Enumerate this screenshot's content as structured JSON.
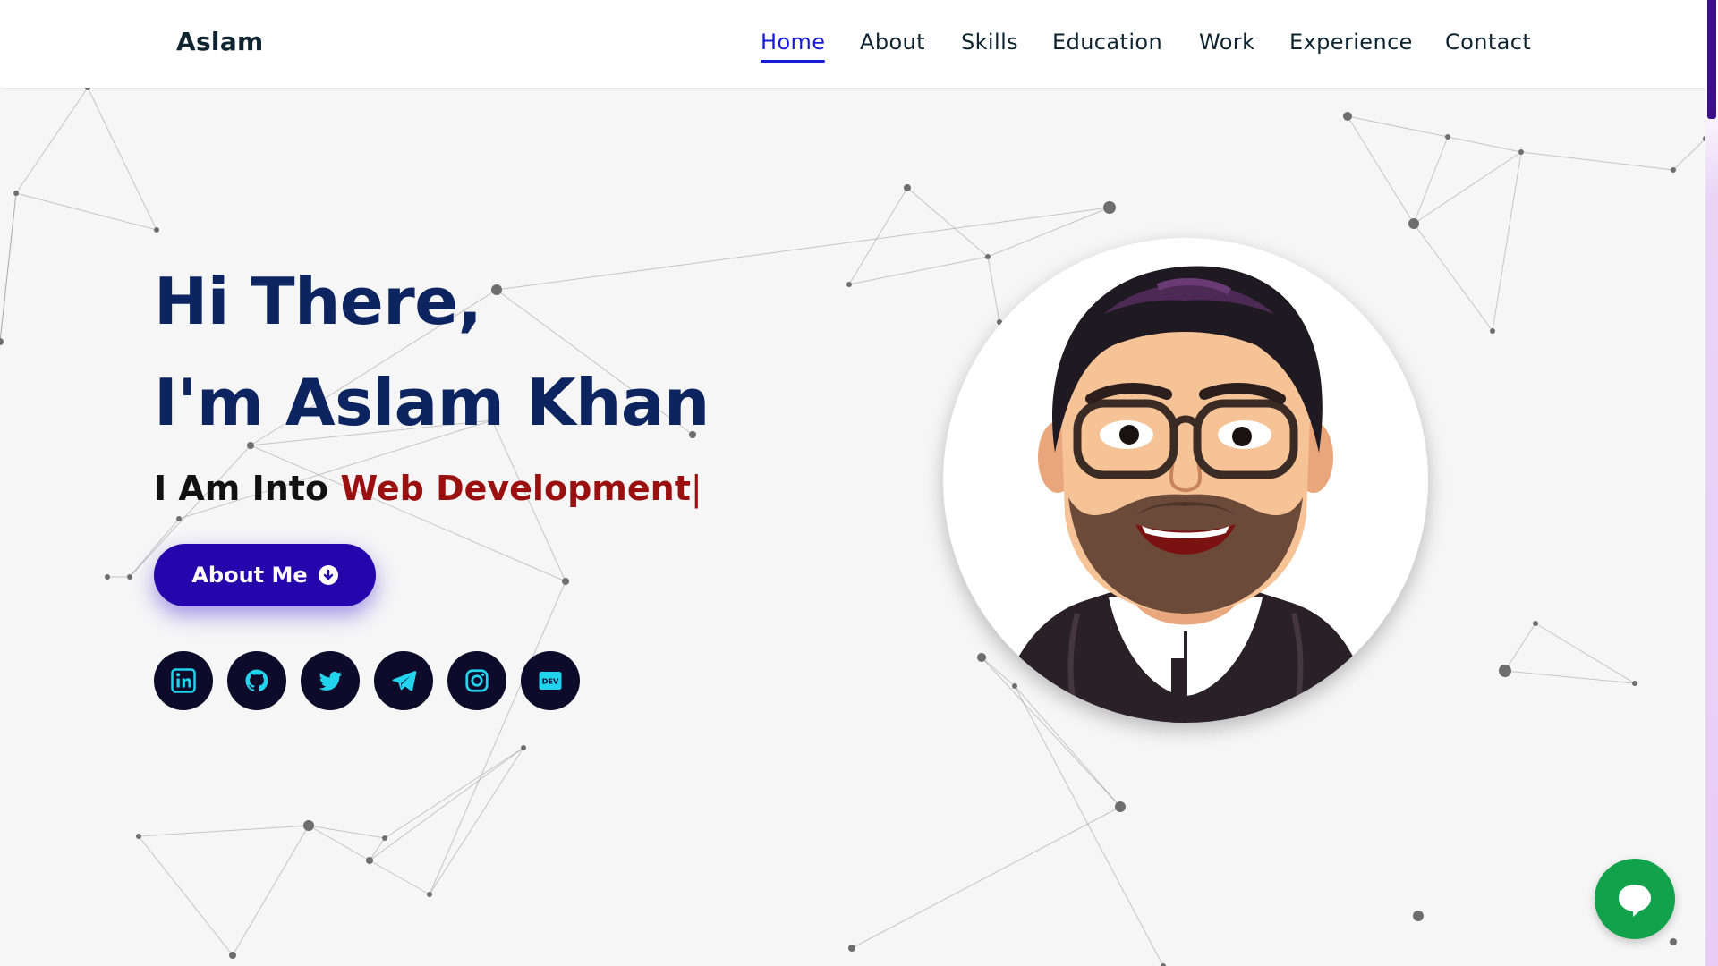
{
  "header": {
    "logo": "Aslam",
    "nav": [
      {
        "label": "Home",
        "active": true
      },
      {
        "label": "About",
        "active": false
      },
      {
        "label": "Skills",
        "active": false
      },
      {
        "label": "Education",
        "active": false
      },
      {
        "label": "Work",
        "active": false
      },
      {
        "label": "Experience",
        "active": false
      },
      {
        "label": "Contact",
        "active": false
      }
    ]
  },
  "hero": {
    "greeting": "Hi There,",
    "name_line": "I'm Aslam Khan",
    "typed_prefix": "I Am Into",
    "typed_role": "Web Development",
    "typed_cursor": "|",
    "button_label": "About Me",
    "socials": [
      {
        "icon": "linkedin-icon"
      },
      {
        "icon": "github-icon"
      },
      {
        "icon": "twitter-icon"
      },
      {
        "icon": "telegram-icon"
      },
      {
        "icon": "instagram-icon"
      },
      {
        "icon": "dev-icon",
        "text": "DEV"
      }
    ]
  },
  "avatar": {
    "icon": "cartoon-avatar"
  },
  "chat": {
    "icon": "chat-bubble-icon"
  },
  "colors": {
    "heading": "#0c2460",
    "accent": "#9a0f0f",
    "button": "#2506ad",
    "social_bg": "#0d0a2a",
    "social_icon": "#22d3ee",
    "nav_active": "#1a1ad9",
    "chat": "#13a24c"
  }
}
